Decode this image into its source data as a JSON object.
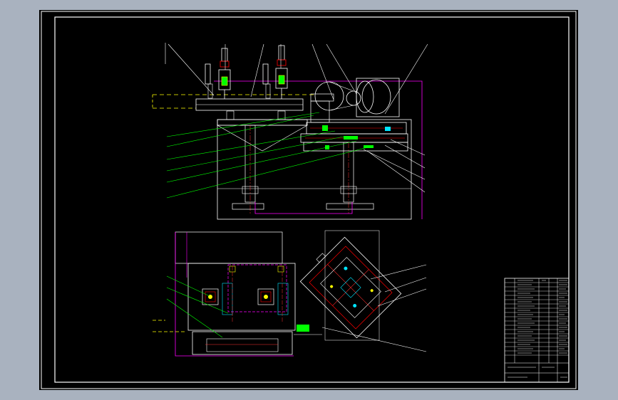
{
  "drawing": {
    "viewer_background": "#a9b2bf",
    "sheet_color": "#000000",
    "line_colors": {
      "outline": "#ffffff",
      "leader": "#00ff00",
      "boundary": "#ff00ff",
      "center": "#ff3030",
      "hatch": "#00e5ff",
      "part": "#ffff00",
      "body": "#ff0000"
    }
  },
  "front_view": {
    "balloon_labels": [
      "",
      "",
      "",
      "",
      "",
      "",
      "",
      ""
    ],
    "right_labels": [
      "",
      "",
      "",
      ""
    ],
    "left_labels": [
      "",
      "",
      "",
      "",
      "",
      ""
    ]
  },
  "plan_view": {
    "left_labels": [
      "",
      "",
      ""
    ],
    "right_labels": [
      "",
      "",
      "",
      ""
    ]
  },
  "notes": {
    "title": "",
    "lines": [
      "",
      "",
      "",
      "",
      "",
      ""
    ]
  },
  "title_block": {
    "rows": [
      "",
      "",
      "",
      "",
      "",
      "",
      "",
      "",
      "",
      "",
      "",
      "",
      "",
      "",
      "",
      "",
      "",
      "",
      "",
      ""
    ]
  }
}
